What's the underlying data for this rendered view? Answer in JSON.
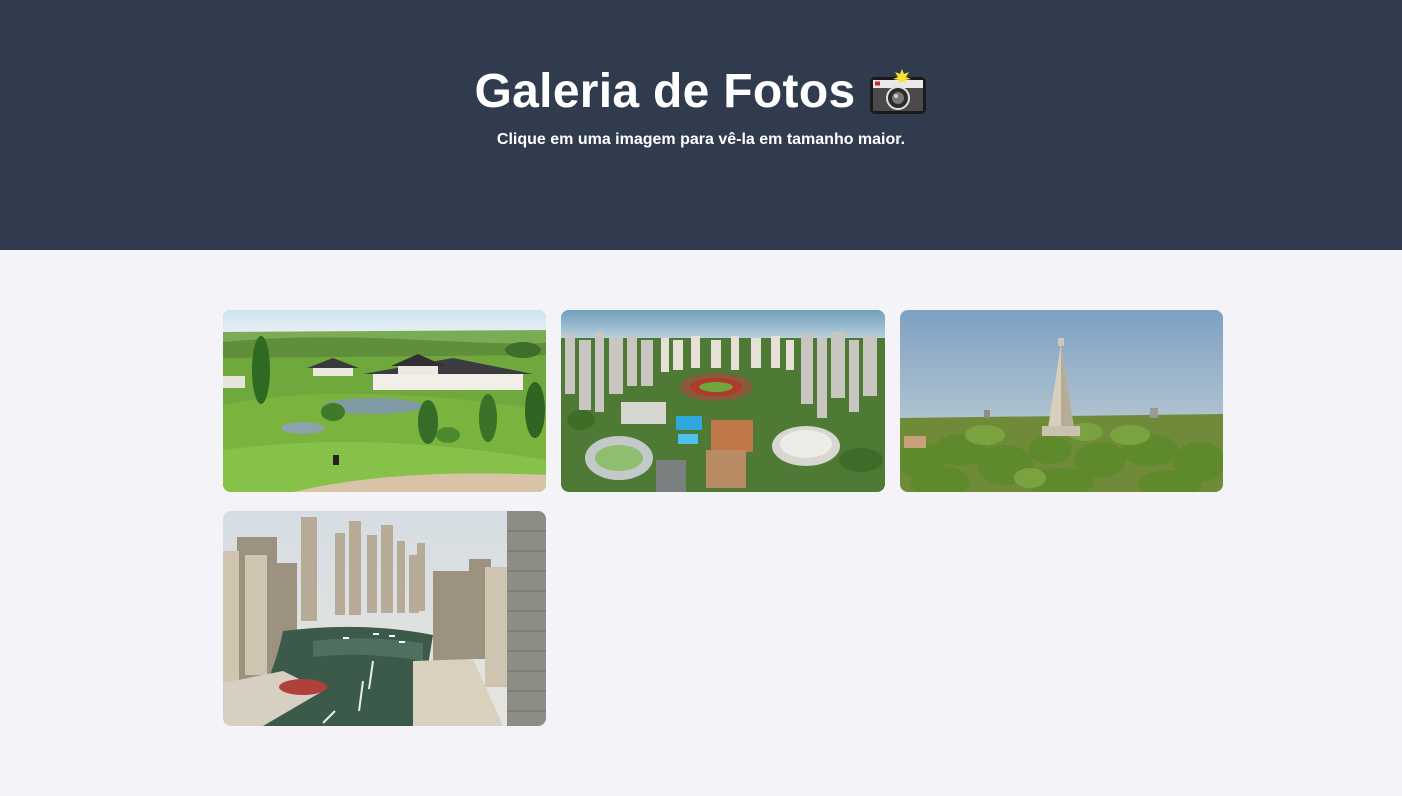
{
  "header": {
    "title": "Galeria de Fotos",
    "title_icon": "camera-flash-icon",
    "subtitle": "Clique em uma imagem para vê-la em tamanho maior."
  },
  "colors": {
    "header_bg": "#313b4e",
    "page_bg": "#f3f3f8",
    "text": "#ffffff"
  },
  "gallery": {
    "photos": [
      {
        "description_icon": "park-with-pagoda-photo"
      },
      {
        "description_icon": "stadium-aerial-photo"
      },
      {
        "description_icon": "cathedral-spire-photo"
      },
      {
        "description_icon": "marina-skyscrapers-photo"
      }
    ]
  }
}
